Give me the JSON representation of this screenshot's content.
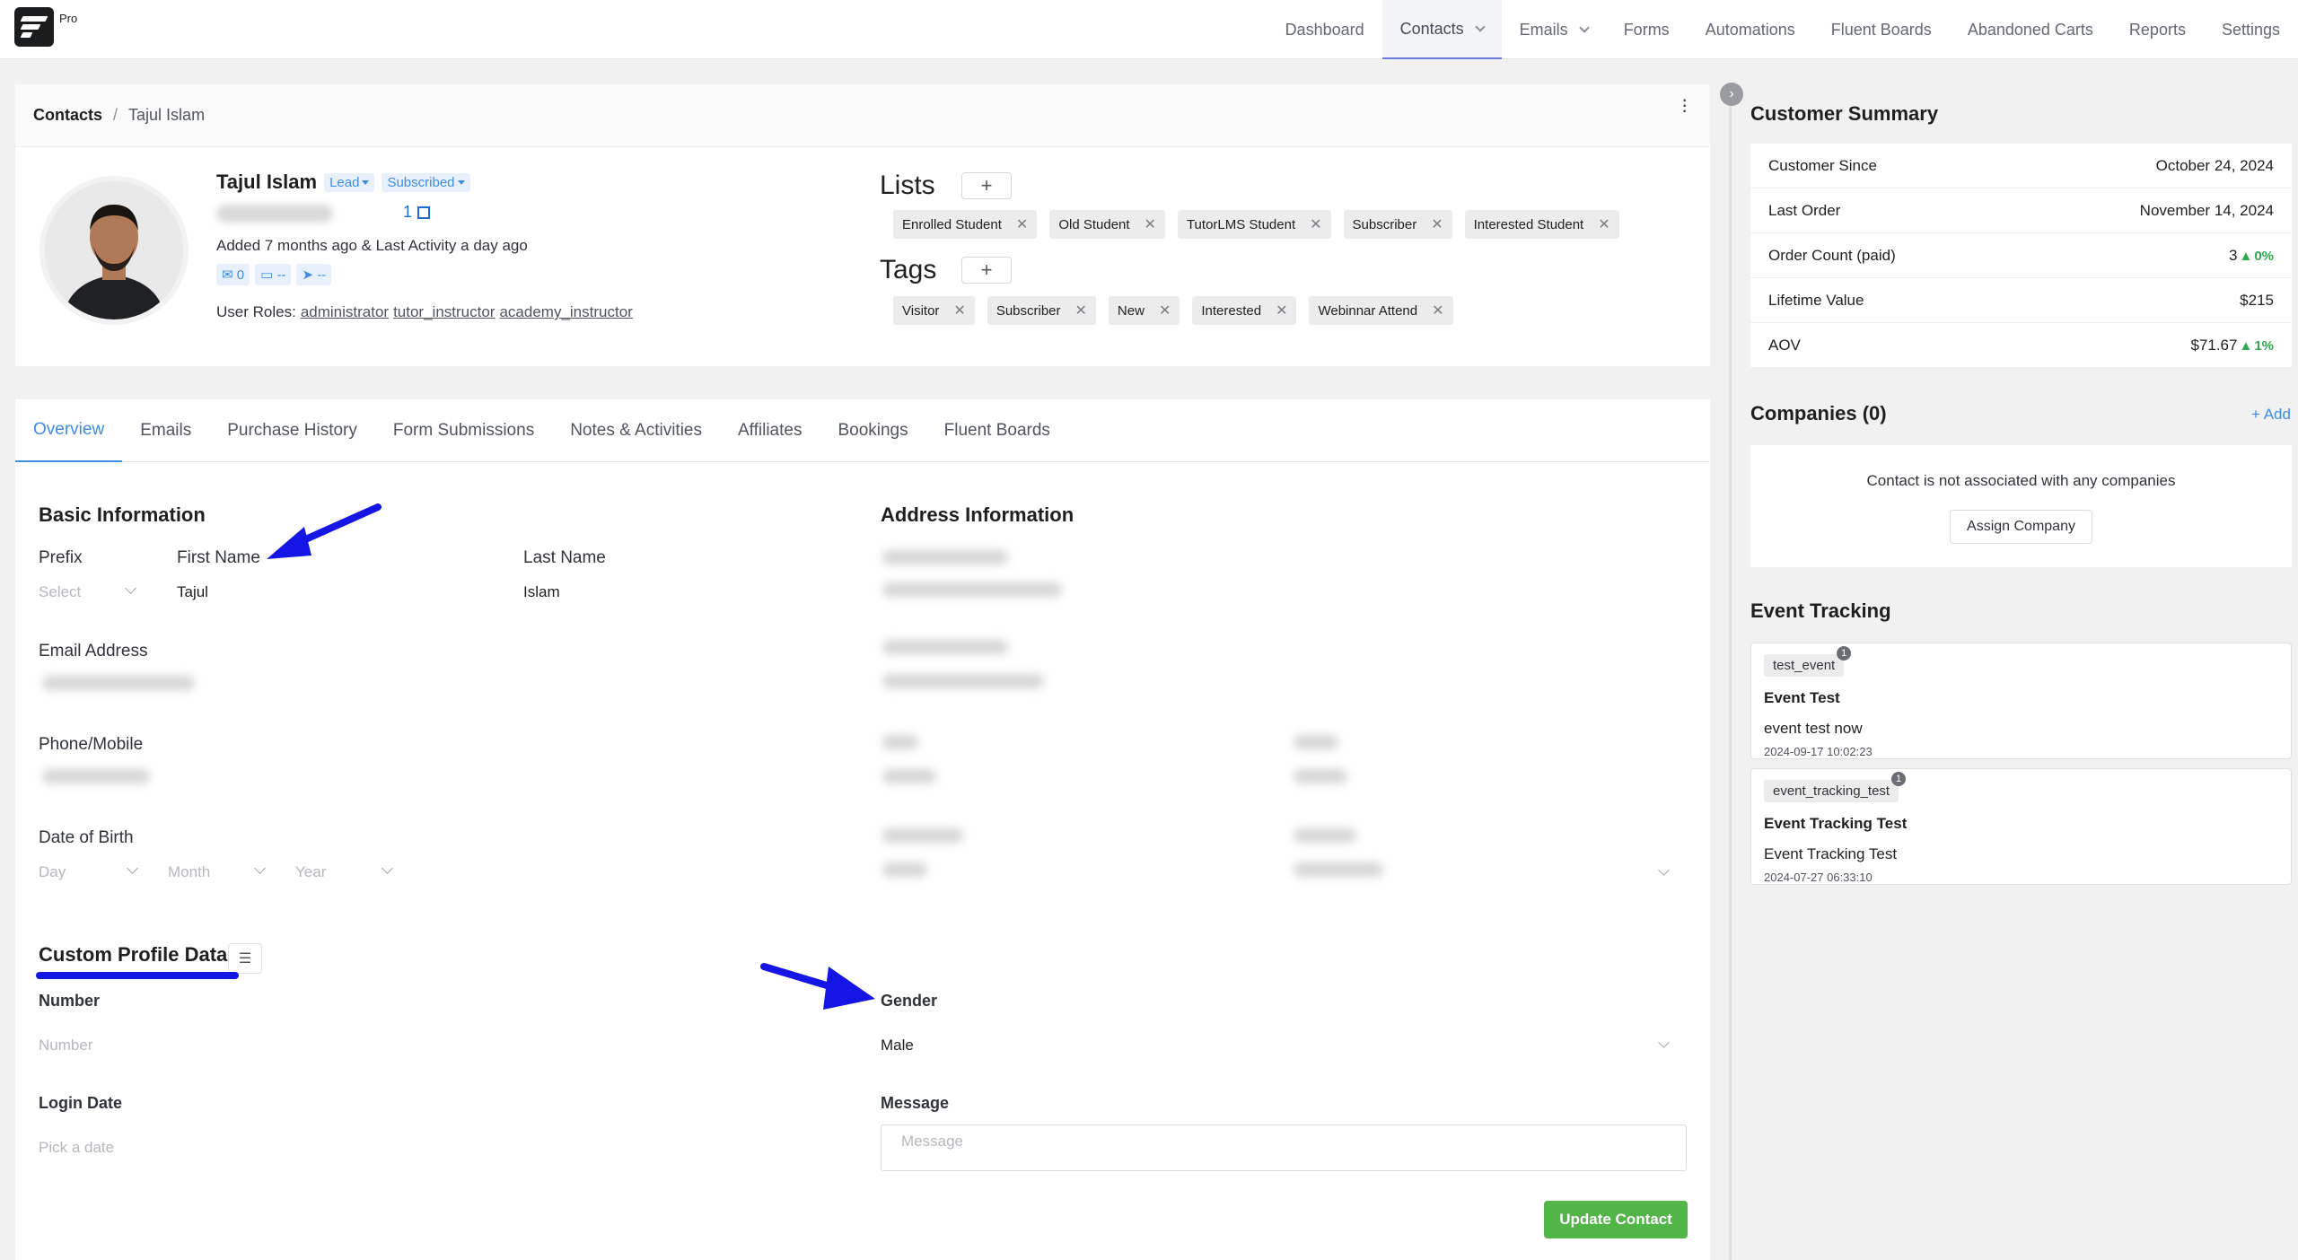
{
  "header": {
    "pro_label": "Pro",
    "nav": [
      "Dashboard",
      "Contacts",
      "Emails",
      "Forms",
      "Automations",
      "Fluent Boards",
      "Abandoned Carts",
      "Reports",
      "Settings"
    ]
  },
  "breadcrumb": {
    "root": "Contacts",
    "current": "Tajul Islam"
  },
  "profile": {
    "name": "Tajul Islam",
    "status_badge": "Lead",
    "subscription_badge": "Subscribed",
    "link_count": "1",
    "added_text": "Added 7 months ago & Last Activity a day ago",
    "email_count": "0",
    "folder_value": "--",
    "send_value": "--",
    "roles_label": "User Roles:",
    "roles": [
      "administrator",
      "tutor_instructor",
      "academy_instructor"
    ]
  },
  "lists": {
    "title": "Lists",
    "items": [
      "Enrolled Student",
      "Old Student",
      "TutorLMS Student",
      "Subscriber",
      "Interested Student"
    ]
  },
  "tags": {
    "title": "Tags",
    "items": [
      "Visitor",
      "Subscriber",
      "New",
      "Interested",
      "Webinnar Attend"
    ]
  },
  "tabs": [
    "Overview",
    "Emails",
    "Purchase History",
    "Form Submissions",
    "Notes & Activities",
    "Affiliates",
    "Bookings",
    "Fluent Boards"
  ],
  "basic_info": {
    "title": "Basic Information",
    "prefix_label": "Prefix",
    "prefix_placeholder": "Select",
    "first_name_label": "First Name",
    "first_name": "Tajul",
    "last_name_label": "Last Name",
    "last_name": "Islam",
    "email_label": "Email Address",
    "phone_label": "Phone/Mobile",
    "dob_label": "Date of Birth",
    "day_placeholder": "Day",
    "month_placeholder": "Month",
    "year_placeholder": "Year"
  },
  "address_info": {
    "title": "Address Information"
  },
  "custom_profile": {
    "title": "Custom Profile Data",
    "number_label": "Number",
    "number_placeholder": "Number",
    "login_date_label": "Login Date",
    "login_date_placeholder": "Pick a date",
    "gender_label": "Gender",
    "gender_value": "Male",
    "message_label": "Message",
    "message_placeholder": "Message",
    "update_button": "Update Contact"
  },
  "customer_summary": {
    "title": "Customer Summary",
    "rows": [
      {
        "label": "Customer Since",
        "value": "October 24, 2024"
      },
      {
        "label": "Last Order",
        "value": "November 14, 2024"
      },
      {
        "label": "Order Count (paid)",
        "value": "3",
        "change": "0%"
      },
      {
        "label": "Lifetime Value",
        "value": "$215"
      },
      {
        "label": "AOV",
        "value": "$71.67",
        "change": "1%"
      }
    ]
  },
  "companies": {
    "title": "Companies (0)",
    "add_link": "+ Add",
    "empty_message": "Contact is not associated with any companies",
    "assign_button": "Assign Company"
  },
  "event_tracking": {
    "title": "Event Tracking",
    "events": [
      {
        "key": "test_event",
        "count": "1",
        "title": "Event Test",
        "description": "event test now",
        "timestamp": "2024-09-17 10:02:23"
      },
      {
        "key": "event_tracking_test",
        "count": "1",
        "title": "Event Tracking Test",
        "description": "Event Tracking Test",
        "timestamp": "2024-07-27 06:33:10"
      }
    ]
  },
  "colors": {
    "accent": "#3e8de3",
    "success": "#52b548",
    "annotation": "#1515e6"
  }
}
